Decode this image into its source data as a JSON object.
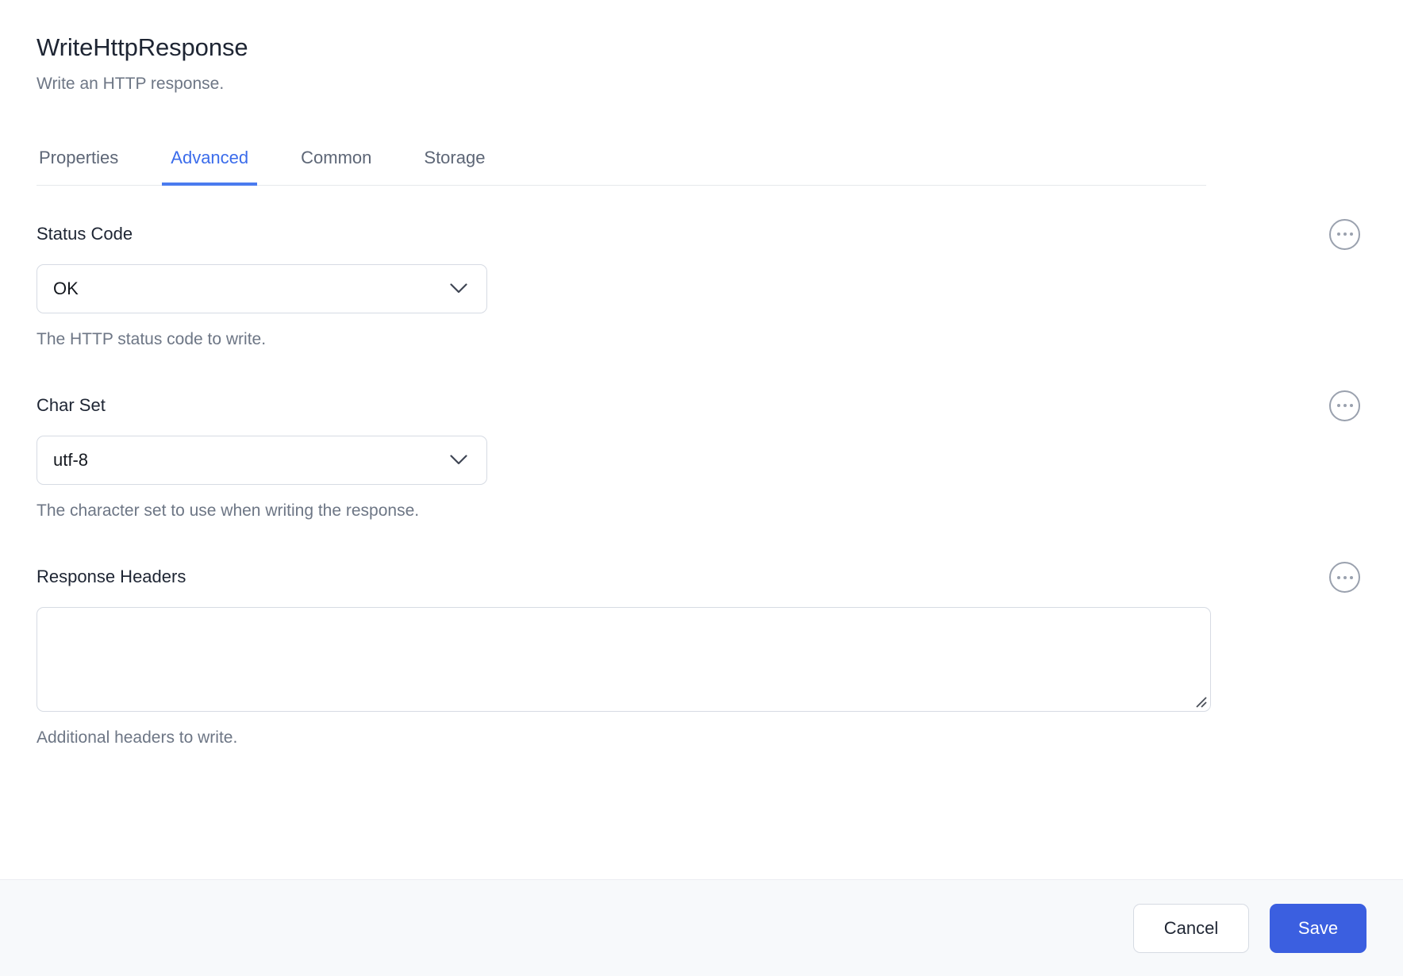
{
  "dialog": {
    "title": "WriteHttpResponse",
    "subtitle": "Write an HTTP response."
  },
  "tabs": [
    {
      "label": "Properties",
      "active": false
    },
    {
      "label": "Advanced",
      "active": true
    },
    {
      "label": "Common",
      "active": false
    },
    {
      "label": "Storage",
      "active": false
    }
  ],
  "fields": [
    {
      "label": "Status Code",
      "control": "select",
      "value": "OK",
      "help": "The HTTP status code to write.",
      "menu_icon": "ellipsis-circle-icon",
      "chevron_icon": "chevron-down-icon"
    },
    {
      "label": "Char Set",
      "control": "select",
      "value": "utf-8",
      "help": "The character set to use when writing the response.",
      "menu_icon": "ellipsis-circle-icon",
      "chevron_icon": "chevron-down-icon"
    },
    {
      "label": "Response Headers",
      "control": "textarea",
      "value": "",
      "placeholder": "",
      "help": "Additional headers to write.",
      "menu_icon": "ellipsis-circle-icon",
      "resize_icon": "resize-handle-icon"
    }
  ],
  "footer": {
    "cancel_label": "Cancel",
    "save_label": "Save"
  },
  "colors": {
    "accent_blue": "#3b6ceb",
    "save_blue": "#3b5fe0",
    "text_dark": "#1e2533",
    "text_muted": "#6d7685",
    "border": "#d6dbe3",
    "footer_bg": "#f7f9fb"
  }
}
